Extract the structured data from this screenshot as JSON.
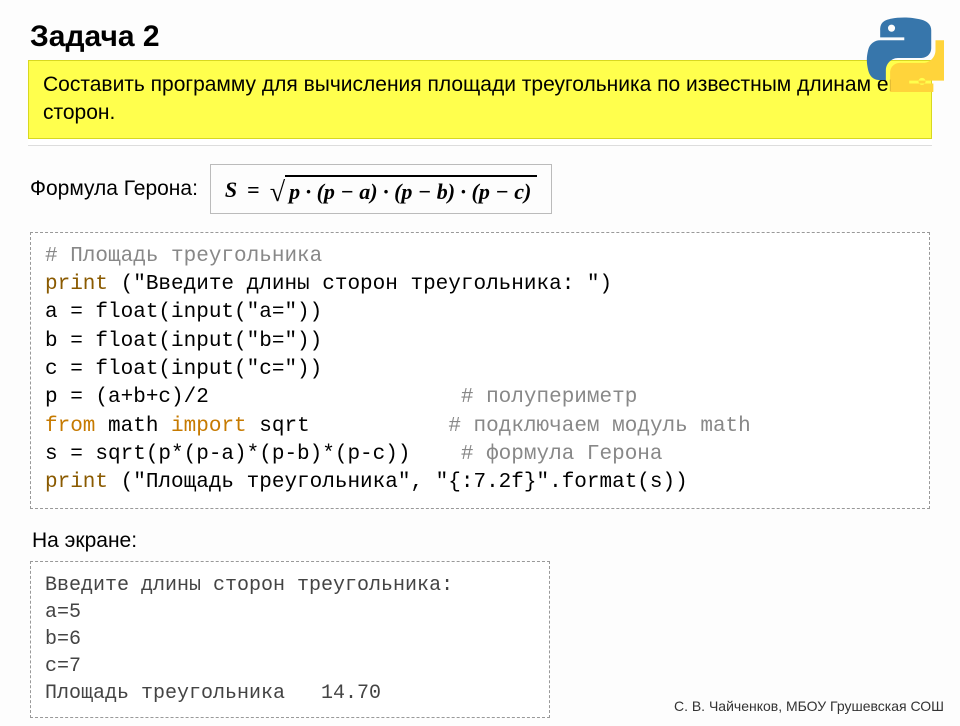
{
  "title": "Задача 2",
  "problem": "Составить программу для вычисления площади треугольника по известным длинам его сторон.",
  "formula_label": "Формула Герона:",
  "formula": {
    "lhs": "S",
    "eq": "=",
    "radicand": "p · (p − a) · (p − b) · (p − c)"
  },
  "code": {
    "l1_comment": "# Площадь треугольника",
    "l2_fn": "print",
    "l2_rest": " (\"Введите длины сторон треугольника: \")",
    "l3": "a = float(input(\"a=\"))",
    "l4": "b = float(input(\"b=\"))",
    "l5": "c = float(input(\"c=\"))",
    "l6a": "p = (a+b+c)/2                    ",
    "l6c": "# полупериметр",
    "l7_from": "from",
    "l7_math": " math ",
    "l7_import": "import",
    "l7_sqrt": " sqrt           ",
    "l7_c": "# подключаем модуль math",
    "l8a": "s = sqrt(p*(p-a)*(p-b)*(p-c))    ",
    "l8c": "# формула Герона",
    "l9_fn": "print",
    "l9_rest": " (\"Площадь треугольника\", \"{:7.2f}\".format(s))"
  },
  "onscreen_label": "На экране:",
  "output": "Введите длины сторон треугольника:\na=5\nb=6\nc=7\nПлощадь треугольника   14.70",
  "footer": "С. В. Чайченков, МБОУ Грушевская СОШ"
}
